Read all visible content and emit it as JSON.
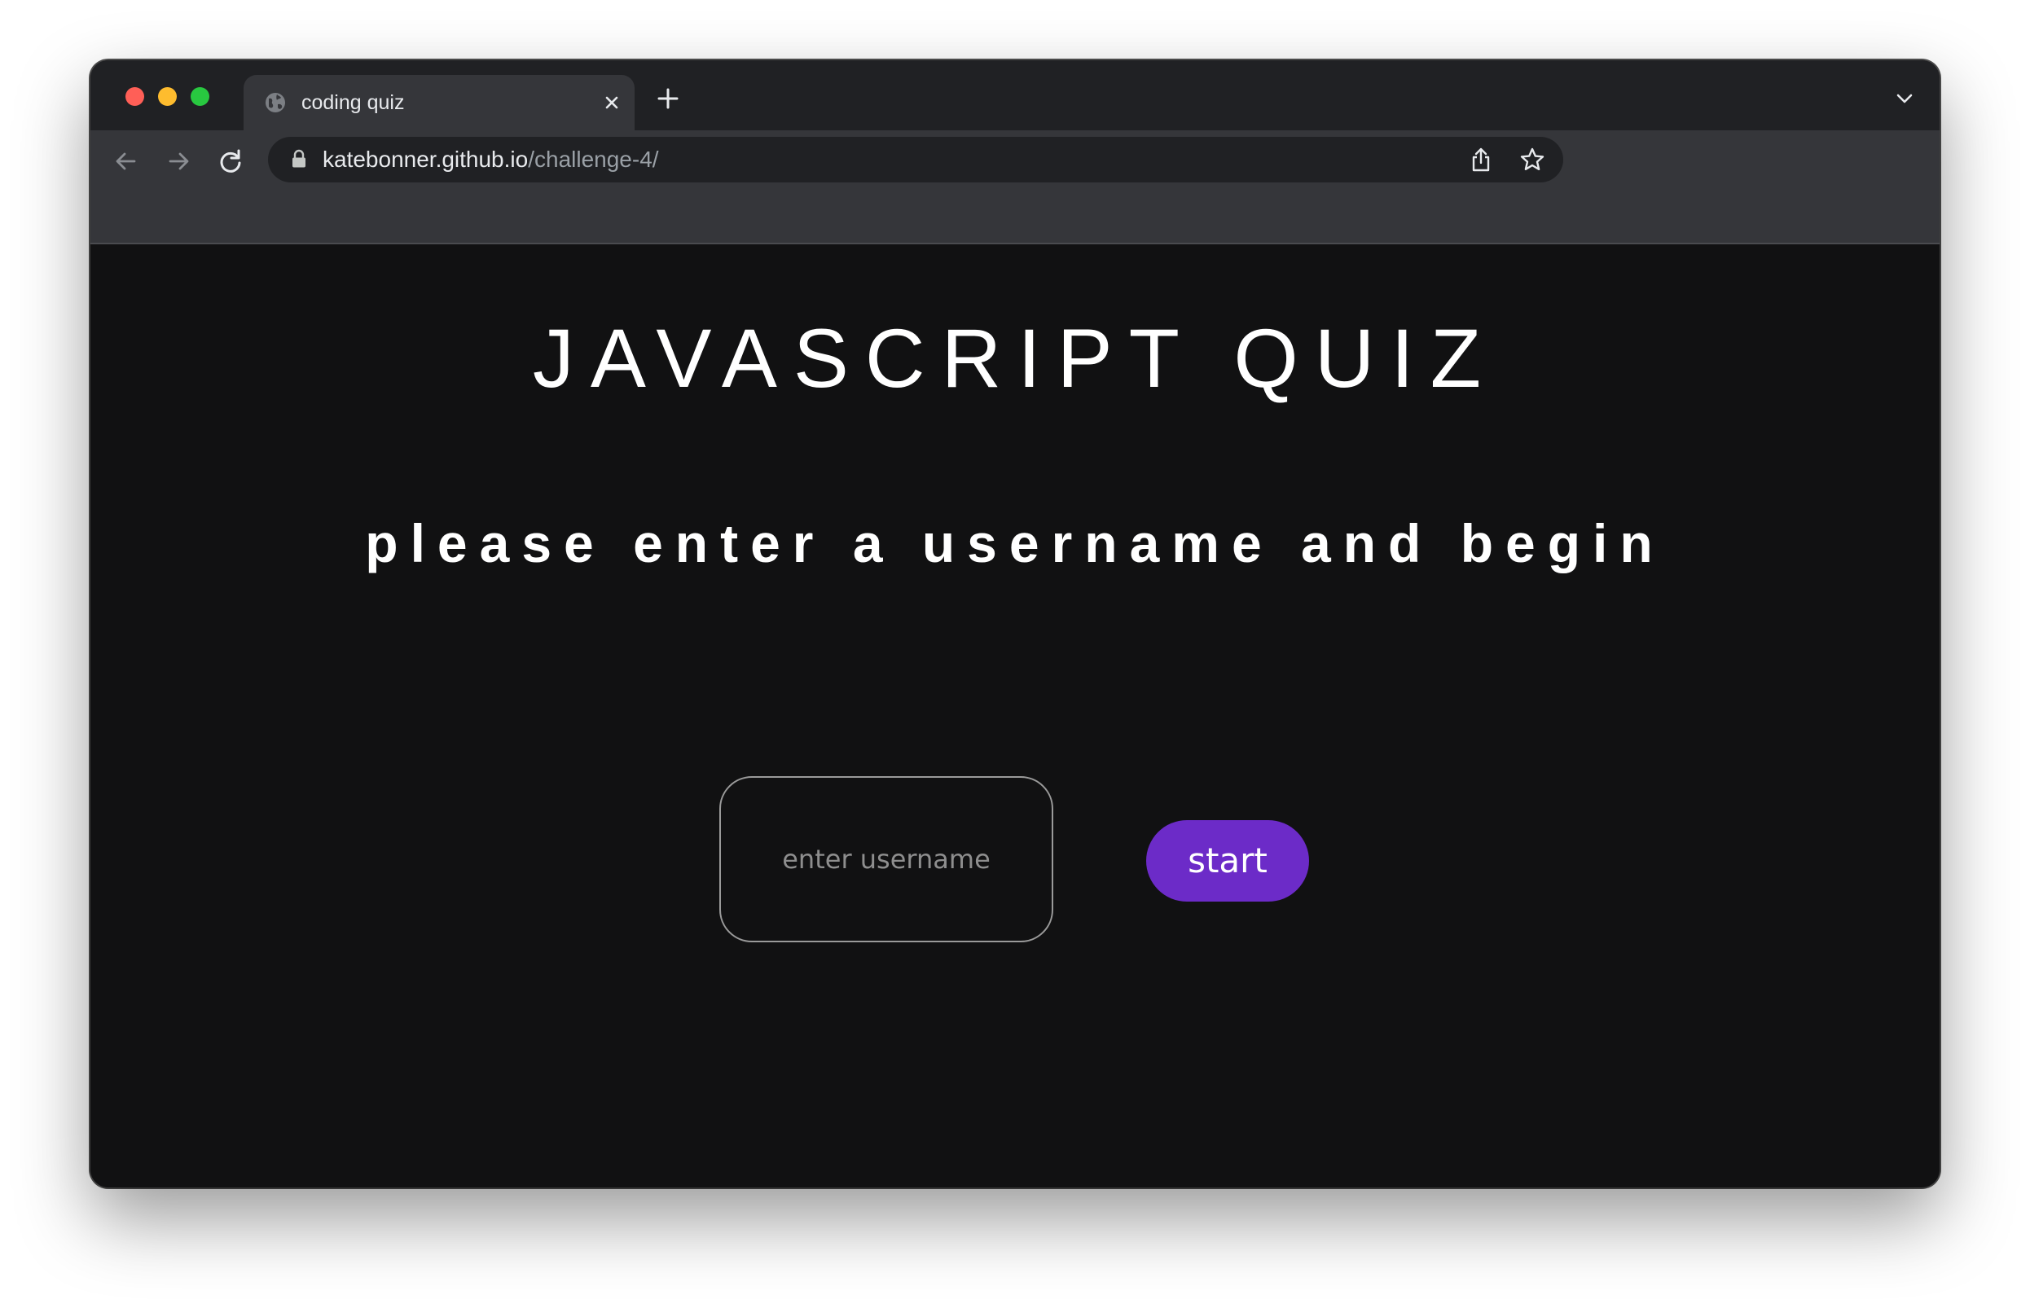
{
  "browser": {
    "tab": {
      "title": "coding quiz",
      "favicon": "globe-icon",
      "close_icon": "close-icon"
    },
    "new_tab_icon": "plus-icon",
    "tab_menu_icon": "chevron-down-icon",
    "nav": {
      "back_icon": "arrow-left-icon",
      "forward_icon": "arrow-right-icon",
      "reload_icon": "reload-icon"
    },
    "address": {
      "host": "katebonner.github.io",
      "path": "/challenge-4/",
      "lock_icon": "lock-icon",
      "share_icon": "share-icon",
      "bookmark_icon": "star-icon"
    }
  },
  "page": {
    "title": "JAVASCRIPT QUIZ",
    "subtitle": "please enter a username and begin",
    "username_input": {
      "placeholder": "enter username",
      "value": ""
    },
    "start_button_label": "start"
  },
  "colors": {
    "page_background": "#111112",
    "text": "#ffffff",
    "start_button": "#6c2bc8",
    "input_border": "#9a9a9a"
  }
}
